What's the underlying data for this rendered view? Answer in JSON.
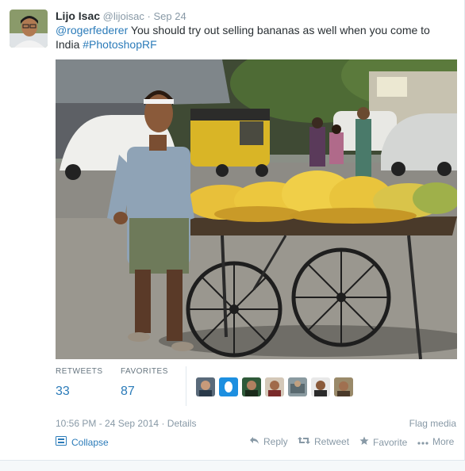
{
  "tweet": {
    "fullname": "Lijo Isac",
    "username": "@lijoisac",
    "separator": "·",
    "date": "Sep 24",
    "mention": "@rogerfederer",
    "text_main": " You should try out  selling  bananas as well when you come to India ",
    "hashtag": "#PhotoshopRF"
  },
  "stats": {
    "retweets_label": "RETWEETS",
    "retweets_value": "33",
    "favorites_label": "FAVORITES",
    "favorites_value": "87"
  },
  "meta": {
    "timestamp": "10:56 PM - 24 Sep 2014",
    "dot": "·",
    "details": "Details",
    "flag": "Flag media"
  },
  "actions": {
    "collapse": "Collapse",
    "reply": "Reply",
    "retweet": "Retweet",
    "favorite": "Favorite",
    "more": "More"
  },
  "icons": {
    "collapse": "collapse-icon",
    "reply": "reply-icon",
    "retweet": "retweet-icon",
    "favorite": "star-icon",
    "more": "more-dots-icon"
  },
  "colors": {
    "link": "#2b7bb9",
    "muted": "#8899a6",
    "text": "#292f33"
  }
}
